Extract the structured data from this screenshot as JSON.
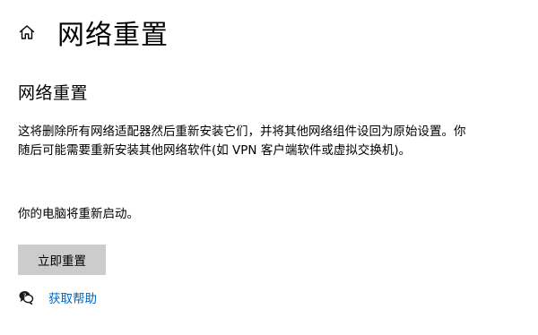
{
  "header": {
    "home_icon": "home-icon",
    "title": "网络重置"
  },
  "main": {
    "section_title": "网络重置",
    "description": "这将删除所有网络适配器然后重新安装它们，并将其他网络组件设回为原始设置。你随后可能需要重新安装其他网络软件(如 VPN 客户端软件或虚拟交换机)。",
    "restart_note": "你的电脑将重新启动。",
    "reset_button_label": "立即重置"
  },
  "help": {
    "icon": "help-chat-icon",
    "link_label": "获取帮助"
  },
  "colors": {
    "link": "#0067c0",
    "button_background": "#cccccc",
    "text": "#000000",
    "background": "#ffffff"
  }
}
